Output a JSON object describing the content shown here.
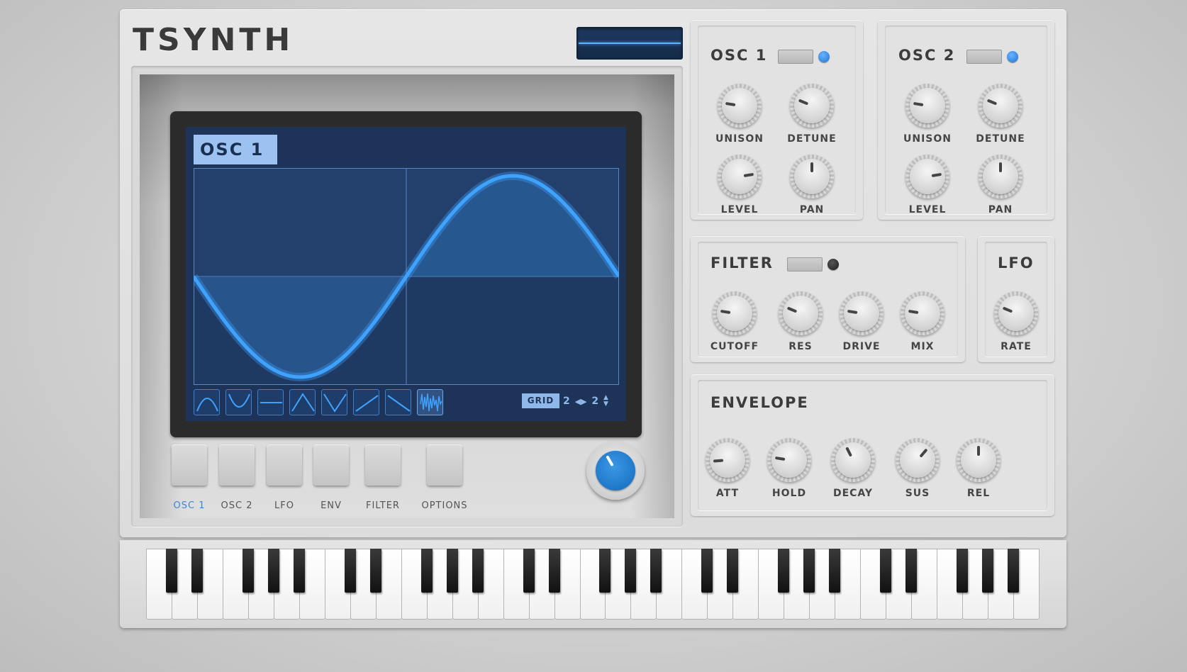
{
  "app": {
    "logo": "TSYNTH"
  },
  "screen": {
    "title": "OSC 1",
    "grid_label": "GRID",
    "grid_x": "2",
    "grid_y": "2",
    "waveforms": [
      {
        "name": "sine-up-icon"
      },
      {
        "name": "sine-down-icon"
      },
      {
        "name": "flat-line-icon"
      },
      {
        "name": "triangle-up-icon"
      },
      {
        "name": "triangle-down-icon"
      },
      {
        "name": "ramp-up-icon"
      },
      {
        "name": "ramp-down-icon"
      },
      {
        "name": "noise-icon"
      }
    ],
    "active_waveform": 7
  },
  "nav": {
    "items": [
      {
        "label": "OSC 1",
        "active": true
      },
      {
        "label": "OSC 2",
        "active": false
      },
      {
        "label": "LFO",
        "active": false
      },
      {
        "label": "ENV",
        "active": false
      },
      {
        "label": "FILTER",
        "active": false
      },
      {
        "label": "OPTIONS",
        "active": false
      }
    ]
  },
  "osc1": {
    "title": "OSC 1",
    "led": "on",
    "knobs": [
      {
        "label": "UNISON",
        "value": 0.2
      },
      {
        "label": "DETUNE",
        "value": 0.25
      },
      {
        "label": "LEVEL",
        "value": 0.8
      },
      {
        "label": "PAN",
        "value": 0.5
      }
    ]
  },
  "osc2": {
    "title": "OSC 2",
    "led": "on",
    "knobs": [
      {
        "label": "UNISON",
        "value": 0.2
      },
      {
        "label": "DETUNE",
        "value": 0.25
      },
      {
        "label": "LEVEL",
        "value": 0.8
      },
      {
        "label": "PAN",
        "value": 0.5
      }
    ]
  },
  "filter": {
    "title": "FILTER",
    "led": "off",
    "knobs": [
      {
        "label": "CUTOFF",
        "value": 0.2
      },
      {
        "label": "RES",
        "value": 0.25
      },
      {
        "label": "DRIVE",
        "value": 0.2
      },
      {
        "label": "MIX",
        "value": 0.2
      }
    ]
  },
  "lfo": {
    "title": "LFO",
    "knobs": [
      {
        "label": "RATE",
        "value": 0.25
      }
    ]
  },
  "envelope": {
    "title": "ENVELOPE",
    "knobs": [
      {
        "label": "ATT",
        "value": 0.15
      },
      {
        "label": "HOLD",
        "value": 0.2
      },
      {
        "label": "DECAY",
        "value": 0.4
      },
      {
        "label": "SUS",
        "value": 0.65
      },
      {
        "label": "REL",
        "value": 0.5
      }
    ]
  },
  "colors": {
    "accent": "#3c86d8",
    "screen_bg": "#1d3358",
    "wave": "#3fa2ff"
  }
}
